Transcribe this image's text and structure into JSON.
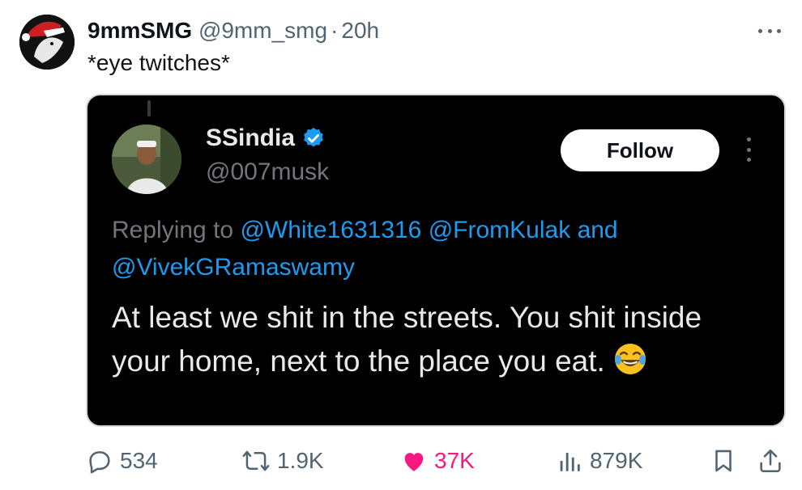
{
  "post": {
    "author_name": "9mmSMG",
    "author_handle": "@9mm_smg",
    "separator": "·",
    "time": "20h",
    "text": "*eye twitches*"
  },
  "embedded": {
    "name": "SSindia",
    "handle": "@007musk",
    "follow_label": "Follow",
    "replying_prefix": "Replying to",
    "mention_1": "@White1631316",
    "mention_2": "@FromKulak",
    "and_word": "and",
    "mention_3": "@VivekGRamaswamy",
    "body": "At least we shit in the streets. You shit inside your home, next to the place you eat.",
    "emoji": "😂"
  },
  "actions": {
    "replies": "534",
    "reposts": "1.9K",
    "likes": "37K",
    "views": "879K"
  },
  "colors": {
    "accent": "#1d9bf0",
    "like": "#f91880",
    "muted": "#536471"
  }
}
